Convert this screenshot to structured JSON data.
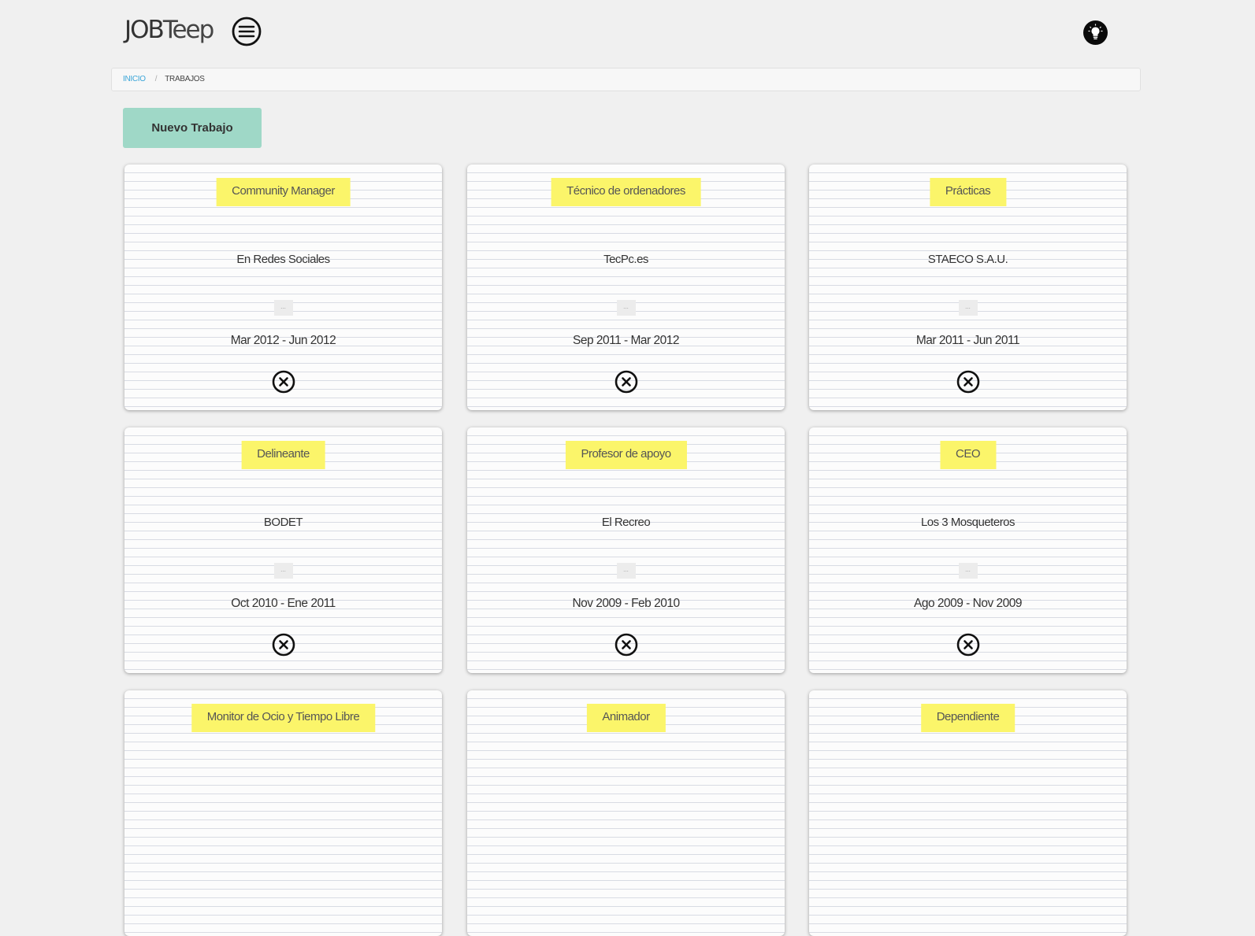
{
  "header": {
    "logo_part1": "JOB",
    "logo_part2": "Teep"
  },
  "breadcrumb": {
    "home": "Inicio",
    "separator": "/",
    "current": "Trabajos"
  },
  "actions": {
    "new_job_label": "Nuevo Trabajo"
  },
  "colors": {
    "accent_button": "#9fd8c7",
    "title_tag": "#fbf56a",
    "link": "#3aa5d8",
    "background": "#f0f0f0"
  },
  "jobs": [
    {
      "title": "Community Manager",
      "company": "En Redes Sociales",
      "dots": "...",
      "dates": "Mar 2012 - Jun 2012"
    },
    {
      "title": "Técnico de ordenadores",
      "company": "TecPc.es",
      "dots": "...",
      "dates": "Sep 2011 - Mar 2012"
    },
    {
      "title": "Prácticas",
      "company": "STAECO S.A.U.",
      "dots": "...",
      "dates": "Mar 2011 - Jun 2011"
    },
    {
      "title": "Delineante",
      "company": "BODET",
      "dots": "...",
      "dates": "Oct 2010 - Ene 2011"
    },
    {
      "title": "Profesor de apoyo",
      "company": "El Recreo",
      "dots": "...",
      "dates": "Nov 2009 - Feb 2010"
    },
    {
      "title": "CEO",
      "company": "Los 3 Mosqueteros",
      "dots": "...",
      "dates": "Ago 2009 - Nov 2009"
    },
    {
      "title": "Monitor de Ocio y Tiempo Libre"
    },
    {
      "title": "Animador"
    },
    {
      "title": "Dependiente"
    }
  ],
  "icons": {
    "menu": "hamburger-menu-icon",
    "idea": "lightbulb-icon",
    "delete": "close-circle-icon"
  }
}
